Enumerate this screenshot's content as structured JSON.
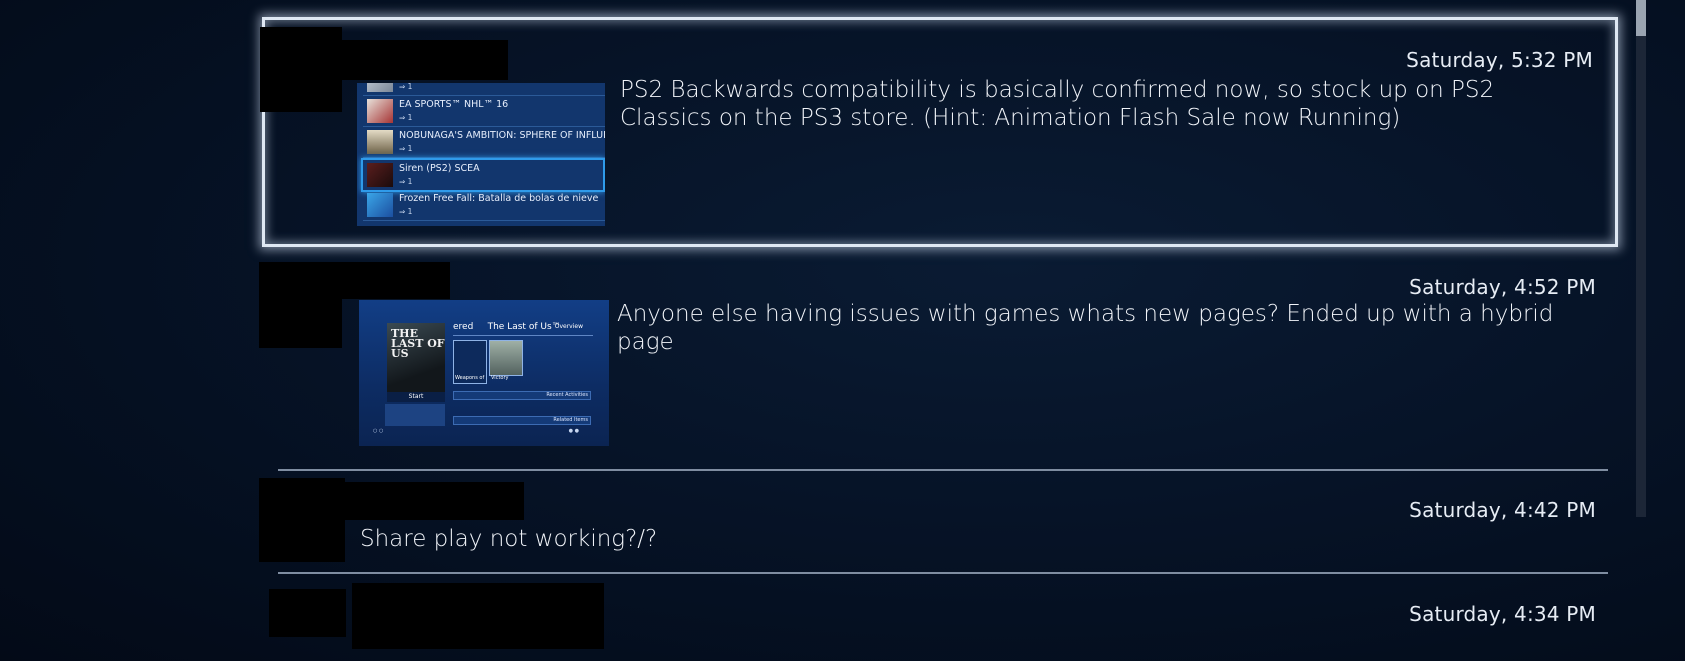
{
  "posts": [
    {
      "timestamp": "Saturday, 5:32 PM",
      "message": "PS2 Backwards compatibility is basically confirmed now, so stock up on PS2 Classics on the PS3 store. (Hint: Animation Flash Sale now Running)",
      "focused": true,
      "screenshot": {
        "type": "game-list",
        "rows": [
          {
            "title": "",
            "count": "1"
          },
          {
            "title": "EA SPORTS™ NHL™ 16",
            "count": "1"
          },
          {
            "title": "NOBUNAGA'S AMBITION: SPHERE OF INFLUENCE",
            "count": "1"
          },
          {
            "title": "Siren (PS2) SCEA",
            "count": "1"
          },
          {
            "title": "Frozen Free Fall: Batalla de bolas de nieve",
            "count": "1"
          }
        ]
      }
    },
    {
      "timestamp": "Saturday, 4:52 PM",
      "message": "Anyone else having issues with games whats new pages? Ended up with a hybrid page",
      "screenshot": {
        "type": "game-page",
        "cover_text": "THE LAST OF US",
        "cover_button": "Start",
        "header_prefix": "ered",
        "header_title": "The Last of Us™",
        "tab": "Overview",
        "tiles": [
          "Weapons of",
          "Victory"
        ],
        "panels": [
          "Recent Activities",
          "Related Items"
        ]
      }
    },
    {
      "timestamp": "Saturday, 4:42 PM",
      "message": "Share play not working?/?"
    },
    {
      "timestamp": "Saturday, 4:34 PM",
      "message": ""
    }
  ]
}
